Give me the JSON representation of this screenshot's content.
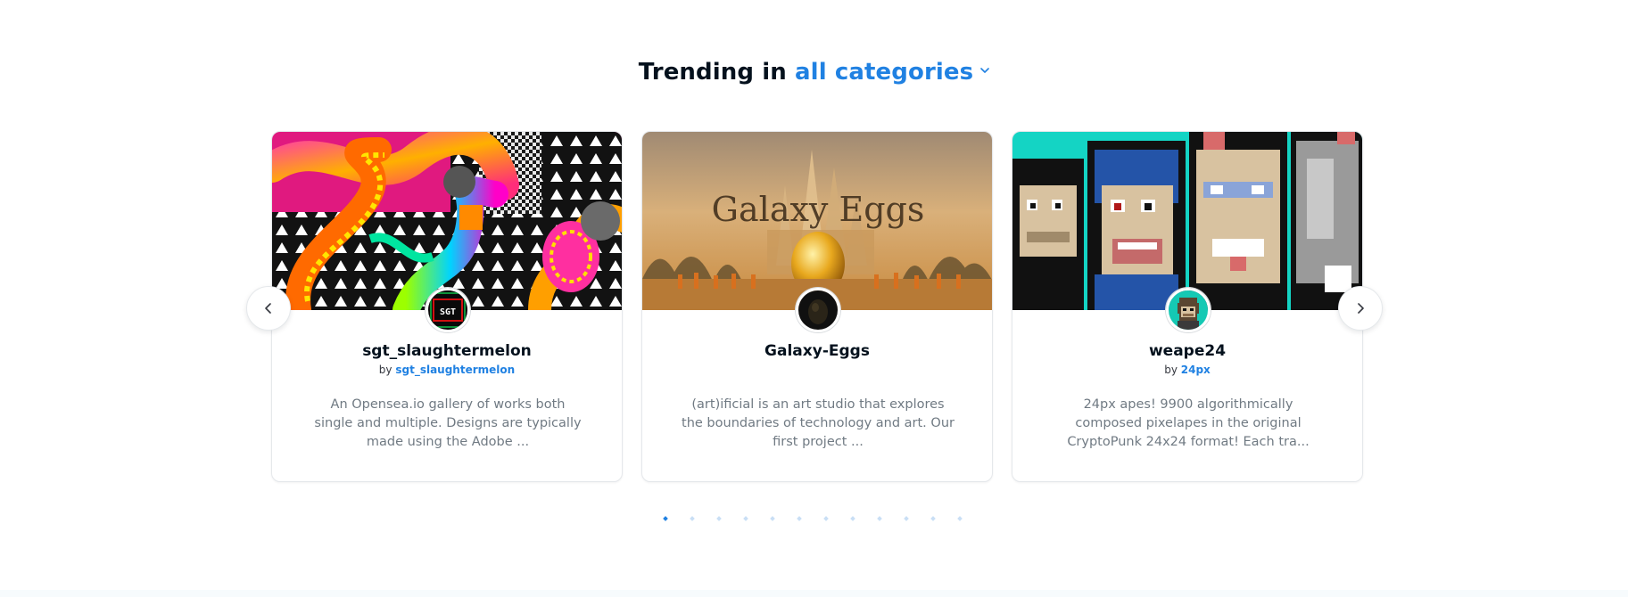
{
  "heading": {
    "prefix": "Trending in",
    "category": "all categories"
  },
  "icons": {
    "dropdown": "chevron-down-icon",
    "prev": "chevron-left-icon",
    "next": "chevron-right-icon"
  },
  "colors": {
    "accent": "#2081e2",
    "text": "#04111d",
    "muted": "#707a83",
    "border": "#e5e8eb"
  },
  "cards": [
    {
      "name": "sgt_slaughtermelon",
      "by_prefix": "by",
      "creator": "sgt_slaughtermelon",
      "description": "An Opensea.io gallery of works both single and multiple. Designs are typically made using the Adobe ...",
      "avatar_text": "SGT"
    },
    {
      "name": "Galaxy-Eggs",
      "banner_text": "Galaxy Eggs",
      "description": "(art)ificial is an art studio that explores the boundaries of technology and art. Our first project ..."
    },
    {
      "name": "weape24",
      "by_prefix": "by",
      "creator": "24px",
      "description": "24px apes! 9900 algorithmically composed pixelapes in the original CryptoPunk 24x24 format! Each tra..."
    }
  ],
  "pagination": {
    "total": 12,
    "active": 1
  }
}
